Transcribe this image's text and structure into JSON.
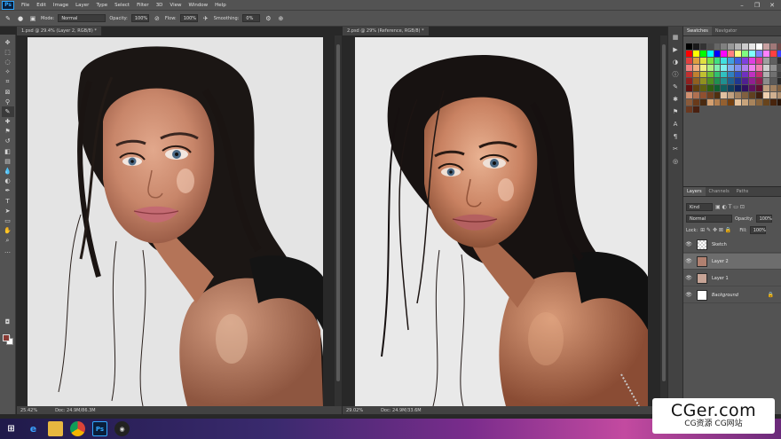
{
  "menu": [
    "File",
    "Edit",
    "Image",
    "Layer",
    "Type",
    "Select",
    "Filter",
    "3D",
    "View",
    "Window",
    "Help"
  ],
  "app_logo": "Ps",
  "options": {
    "mode_label": "Mode:",
    "mode_value": "Normal",
    "opacity_label": "Opacity:",
    "opacity_value": "100%",
    "flow_label": "Flow:",
    "flow_value": "100%",
    "smoothing_label": "Smoothing:",
    "smoothing_value": "0%"
  },
  "documents": [
    {
      "tab": "1.psd @ 29.4% (Layer 2, RGB/8) *",
      "zoom": "25.42%",
      "doc_size": "Doc: 24.9M/86.3M"
    },
    {
      "tab": "2.psd @ 29% (Reference, RGB/8) *",
      "zoom": "29.02%",
      "doc_size": "Doc: 24.9M/33.6M"
    }
  ],
  "swatches_panel": {
    "tabs": [
      "Swatches",
      "Navigator"
    ]
  },
  "layers_panel": {
    "tabs": [
      "Layers",
      "Channels",
      "Paths"
    ],
    "filter_kind": "Kind",
    "blend_mode": "Normal",
    "opacity_label": "Opacity:",
    "opacity_value": "100%",
    "lock_label": "Lock:",
    "fill_label": "Fill:",
    "fill_value": "100%",
    "layers": [
      {
        "name": "Sketch",
        "selected": false
      },
      {
        "name": "Layer 2",
        "selected": true
      },
      {
        "name": "Layer 1",
        "selected": false
      },
      {
        "name": "Background",
        "selected": false
      }
    ]
  },
  "watermark": {
    "line1": "CGer.com",
    "line2": "CG资源 CG网站"
  },
  "taskbar_icons": [
    "windows-start-icon",
    "ie-icon",
    "file-explorer-icon",
    "chrome-icon",
    "photoshop-icon",
    "obs-icon"
  ],
  "colors": {
    "foreground": "#8a3a34",
    "background": "#ffffff"
  }
}
